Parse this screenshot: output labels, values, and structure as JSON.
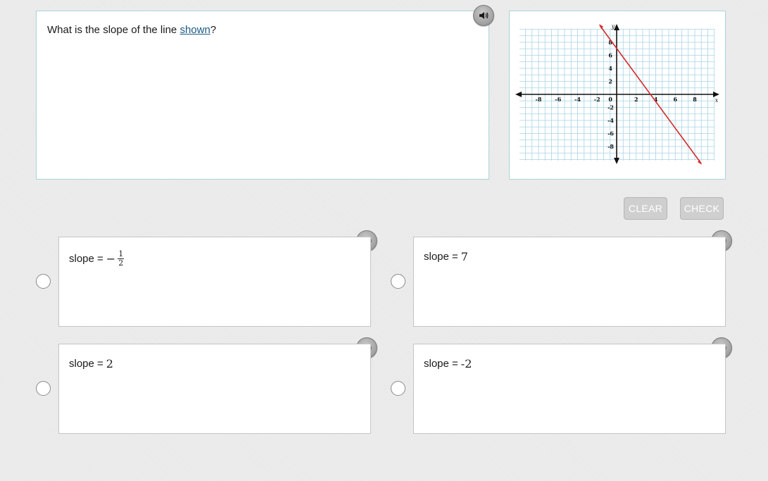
{
  "question": {
    "prefix": "What is the slope of the line ",
    "link": "shown",
    "suffix": "?"
  },
  "graph": {
    "x_ticks": [
      "-8",
      "-6",
      "-4",
      "-2",
      "2",
      "4",
      "6",
      "8"
    ],
    "y_ticks_pos": [
      "8",
      "6",
      "4",
      "2"
    ],
    "y_ticks_neg": [
      "-2",
      "-4",
      "-6",
      "-8"
    ],
    "origin_label": "0",
    "x_axis_label": "x",
    "y_axis_label": "y",
    "line_color": "#d42b2b"
  },
  "buttons": {
    "clear": "CLEAR",
    "check": "CHECK"
  },
  "choices": {
    "a": {
      "label": "slope = ",
      "sign": "−",
      "num": "1",
      "den": "2"
    },
    "b": {
      "label": "slope = ",
      "value": "7"
    },
    "c": {
      "label": "slope = ",
      "value": "2"
    },
    "d": {
      "label": "slope = ",
      "value": "-2"
    }
  },
  "icons": {
    "audio": "speaker-icon"
  }
}
